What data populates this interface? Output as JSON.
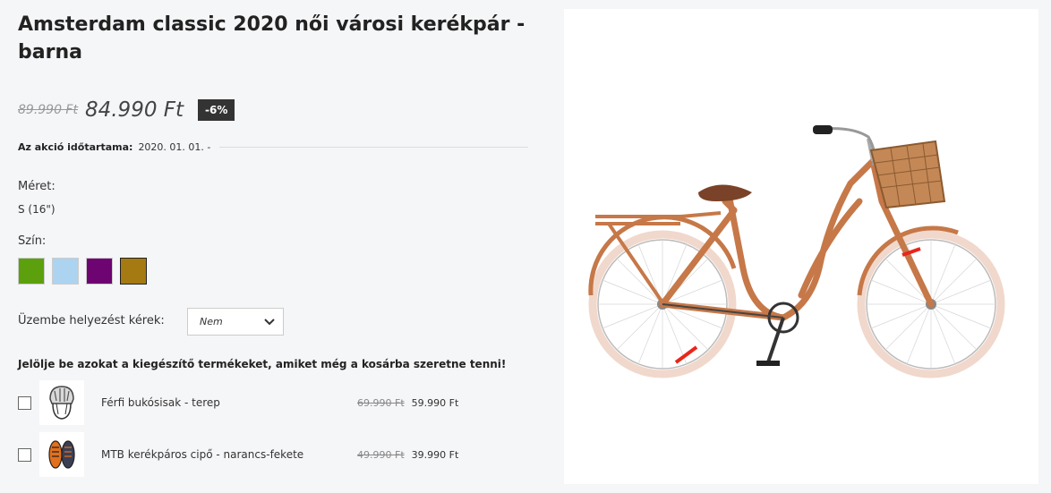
{
  "product": {
    "title": "Amsterdam classic 2020 női városi kerékpár - barna",
    "old_price": "89.990 Ft",
    "new_price": "84.990 Ft",
    "discount": "-6%"
  },
  "sale": {
    "label": "Az akció időtartama:",
    "value": "2020. 01. 01. -"
  },
  "size": {
    "label": "Méret:",
    "value": "S (16\")"
  },
  "color": {
    "label": "Szín:",
    "swatches": [
      "#5ca00e",
      "#acd3f0",
      "#6d0472",
      "#a57a12"
    ],
    "selected_index": 3
  },
  "setup": {
    "label": "Üzembe helyezést kérek:",
    "selected": "Nem"
  },
  "accessories": {
    "heading": "Jelölje be azokat a kiegészítő termékeket, amiket még a kosárba szeretne tenni!",
    "items": [
      {
        "name": "Férfi bukósisak - terep",
        "old_price": "69.990 Ft",
        "new_price": "59.990 Ft",
        "icon": "helmet-icon"
      },
      {
        "name": "MTB kerékpáros cipő - narancs-fekete",
        "old_price": "49.990 Ft",
        "new_price": "39.990 Ft",
        "icon": "shoes-icon"
      }
    ]
  },
  "colors": {
    "bike_frame": "#c67848",
    "tire": "#f1d8cc",
    "accent_red": "#e8261a"
  }
}
